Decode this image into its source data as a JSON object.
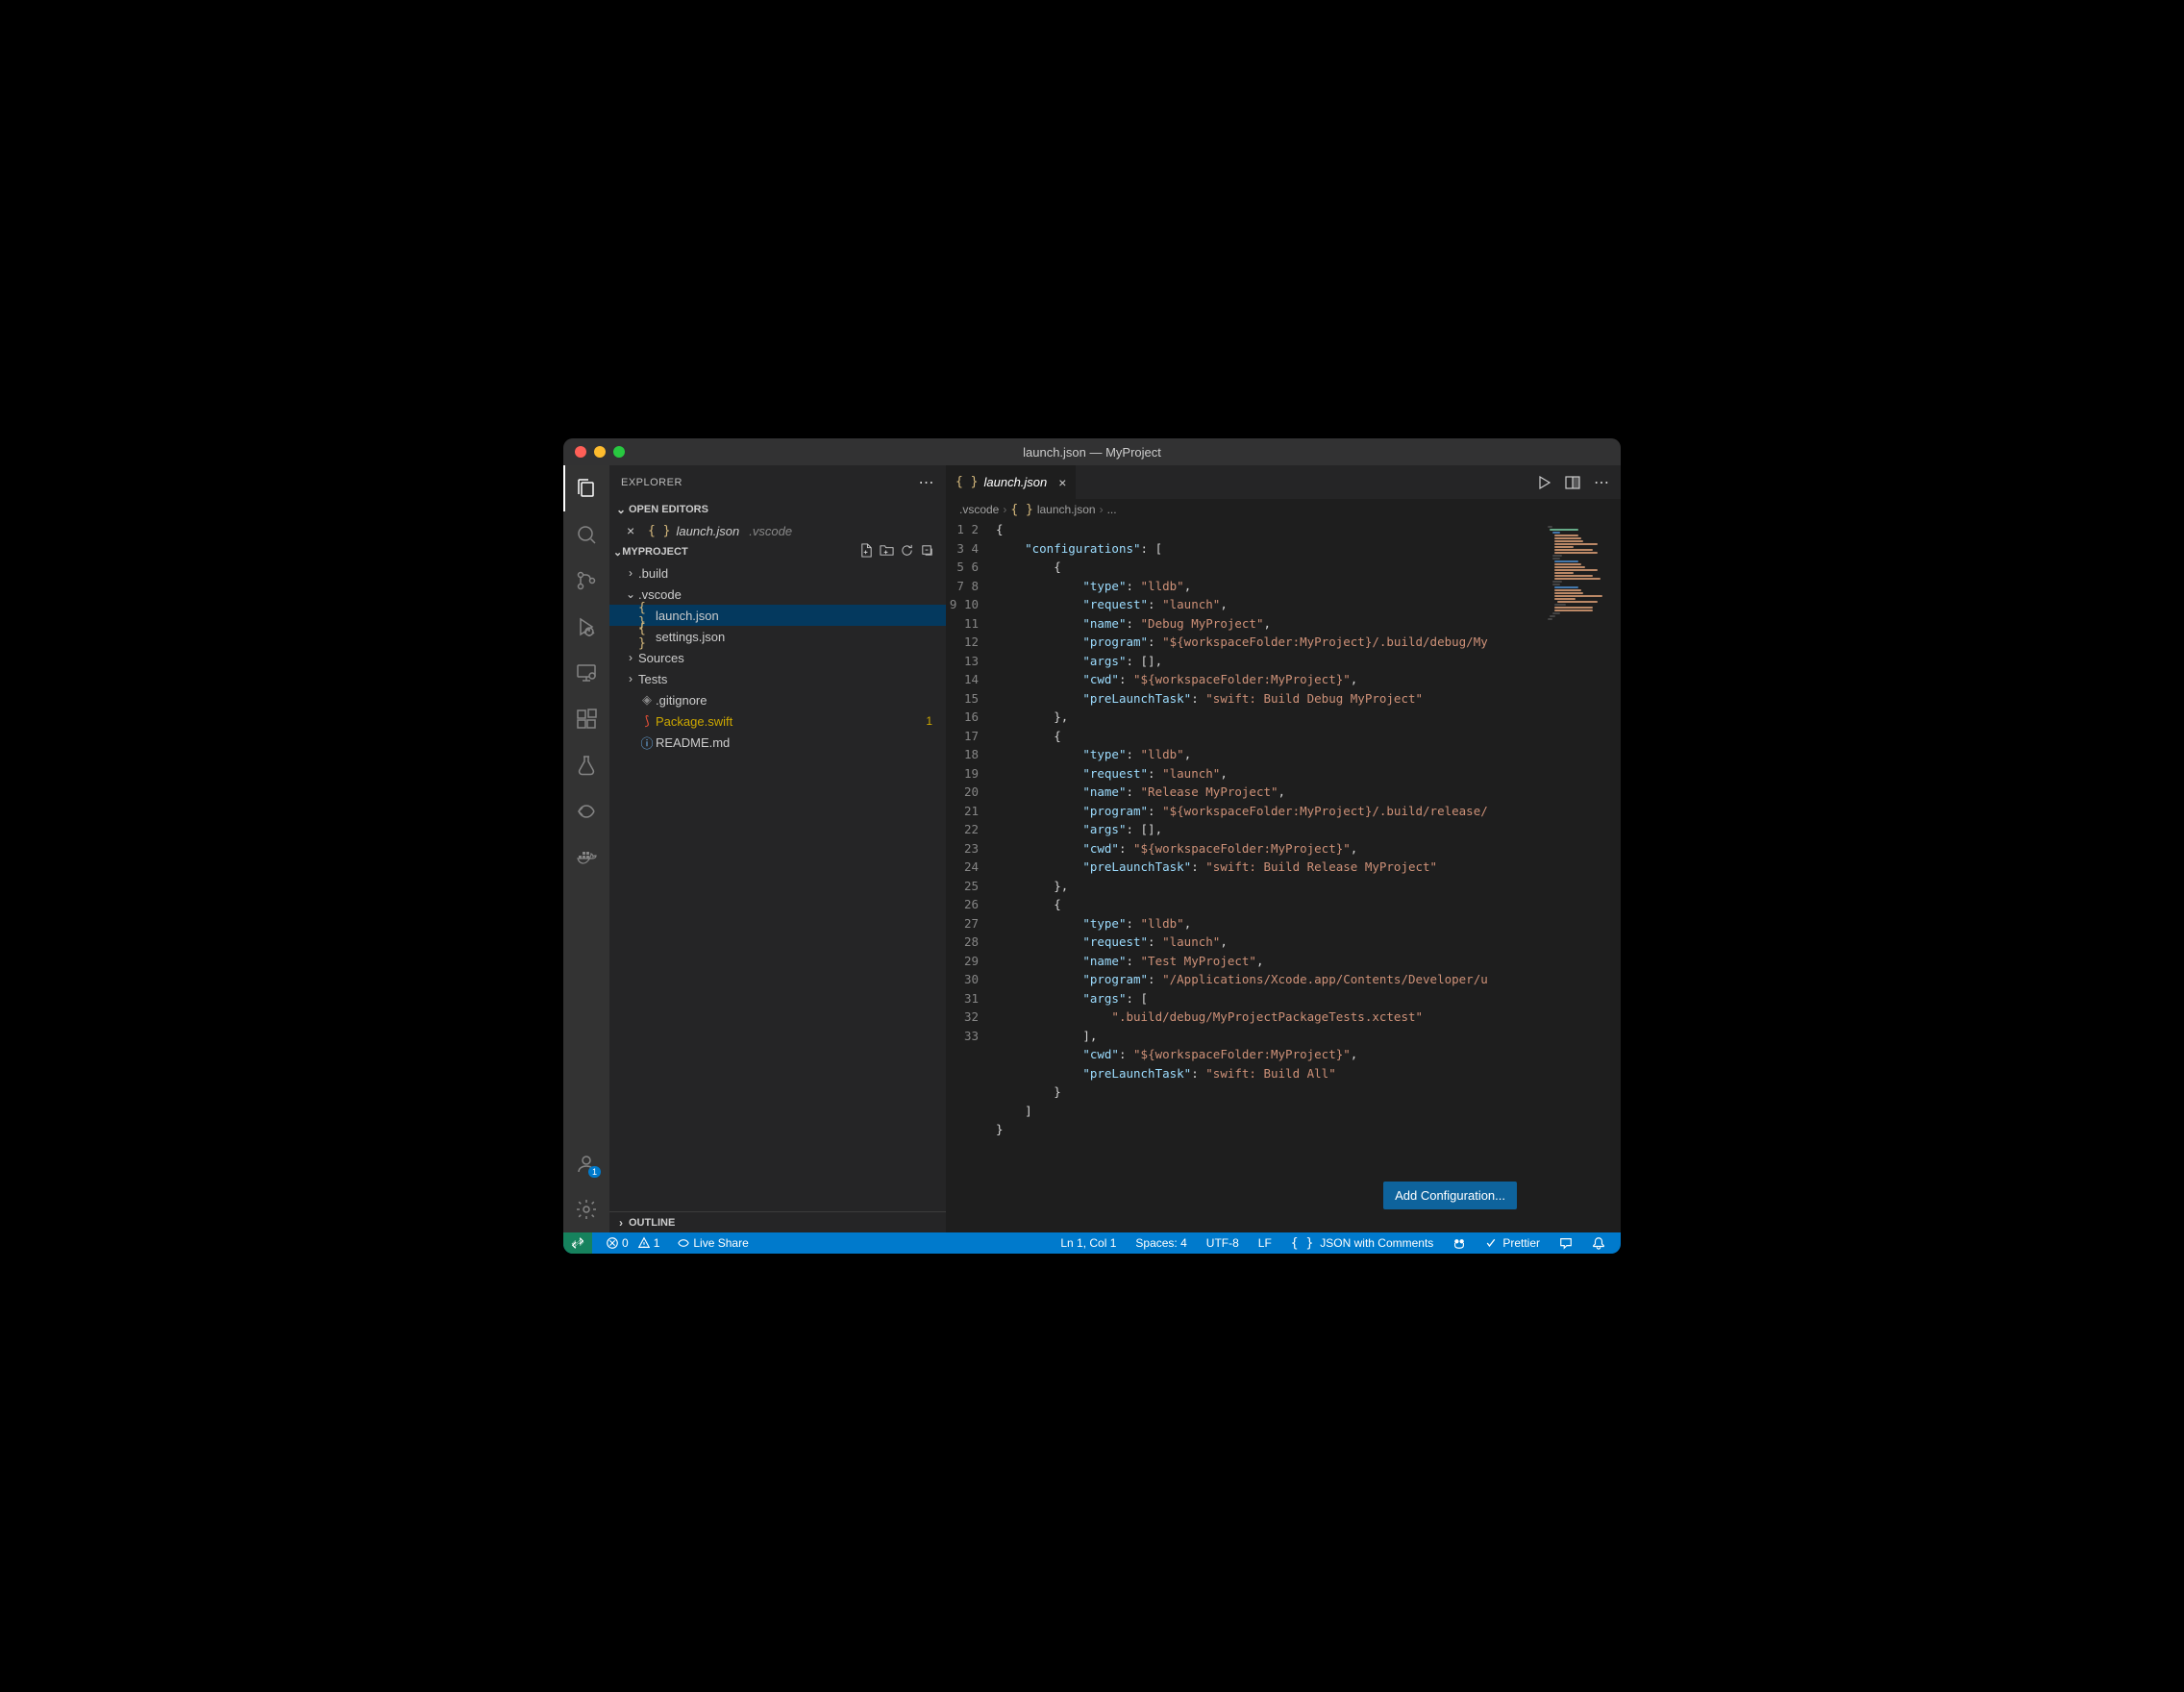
{
  "window": {
    "title": "launch.json — MyProject"
  },
  "sidebar": {
    "title": "EXPLORER",
    "openEditorsLabel": "OPEN EDITORS",
    "openEditors": [
      {
        "name": "launch.json",
        "dir": ".vscode"
      }
    ],
    "projectName": "MYPROJECT",
    "tree": {
      "build": ".build",
      "vscode": ".vscode",
      "launch": "launch.json",
      "settings": "settings.json",
      "sources": "Sources",
      "tests": "Tests",
      "gitignore": ".gitignore",
      "package": "Package.swift",
      "packageBadge": "1",
      "readme": "README.md"
    },
    "outlineLabel": "OUTLINE"
  },
  "tabs": {
    "activeFile": "launch.json"
  },
  "breadcrumb": {
    "p1": ".vscode",
    "p2": "launch.json",
    "p3": "..."
  },
  "editor": {
    "lineCount": 33,
    "addConfigLabel": "Add Configuration..."
  },
  "code": {
    "configurationsKey": "\"configurations\"",
    "typeKey": "\"type\"",
    "requestKey": "\"request\"",
    "nameKey": "\"name\"",
    "programKey": "\"program\"",
    "argsKey": "\"args\"",
    "cwdKey": "\"cwd\"",
    "preLaunchTaskKey": "\"preLaunchTask\"",
    "lldb": "\"lldb\"",
    "launch": "\"launch\"",
    "debugName": "\"Debug MyProject\"",
    "debugProgram": "\"${workspaceFolder:MyProject}/.build/debug/My",
    "cwdVal": "\"${workspaceFolder:MyProject}\"",
    "debugPreLaunch": "\"swift: Build Debug MyProject\"",
    "releaseName": "\"Release MyProject\"",
    "releaseProgram": "\"${workspaceFolder:MyProject}/.build/release/",
    "releasePreLaunch": "\"swift: Build Release MyProject\"",
    "testName": "\"Test MyProject\"",
    "testProgram": "\"/Applications/Xcode.app/Contents/Developer/u",
    "testArg": "\".build/debug/MyProjectPackageTests.xctest\"",
    "testPreLaunch": "\"swift: Build All\""
  },
  "statusBar": {
    "errors": "0",
    "warnings": "1",
    "liveShare": "Live Share",
    "cursor": "Ln 1, Col 1",
    "spaces": "Spaces: 4",
    "encoding": "UTF-8",
    "eol": "LF",
    "lang": "JSON with Comments",
    "prettier": "Prettier"
  },
  "accountBadge": "1"
}
